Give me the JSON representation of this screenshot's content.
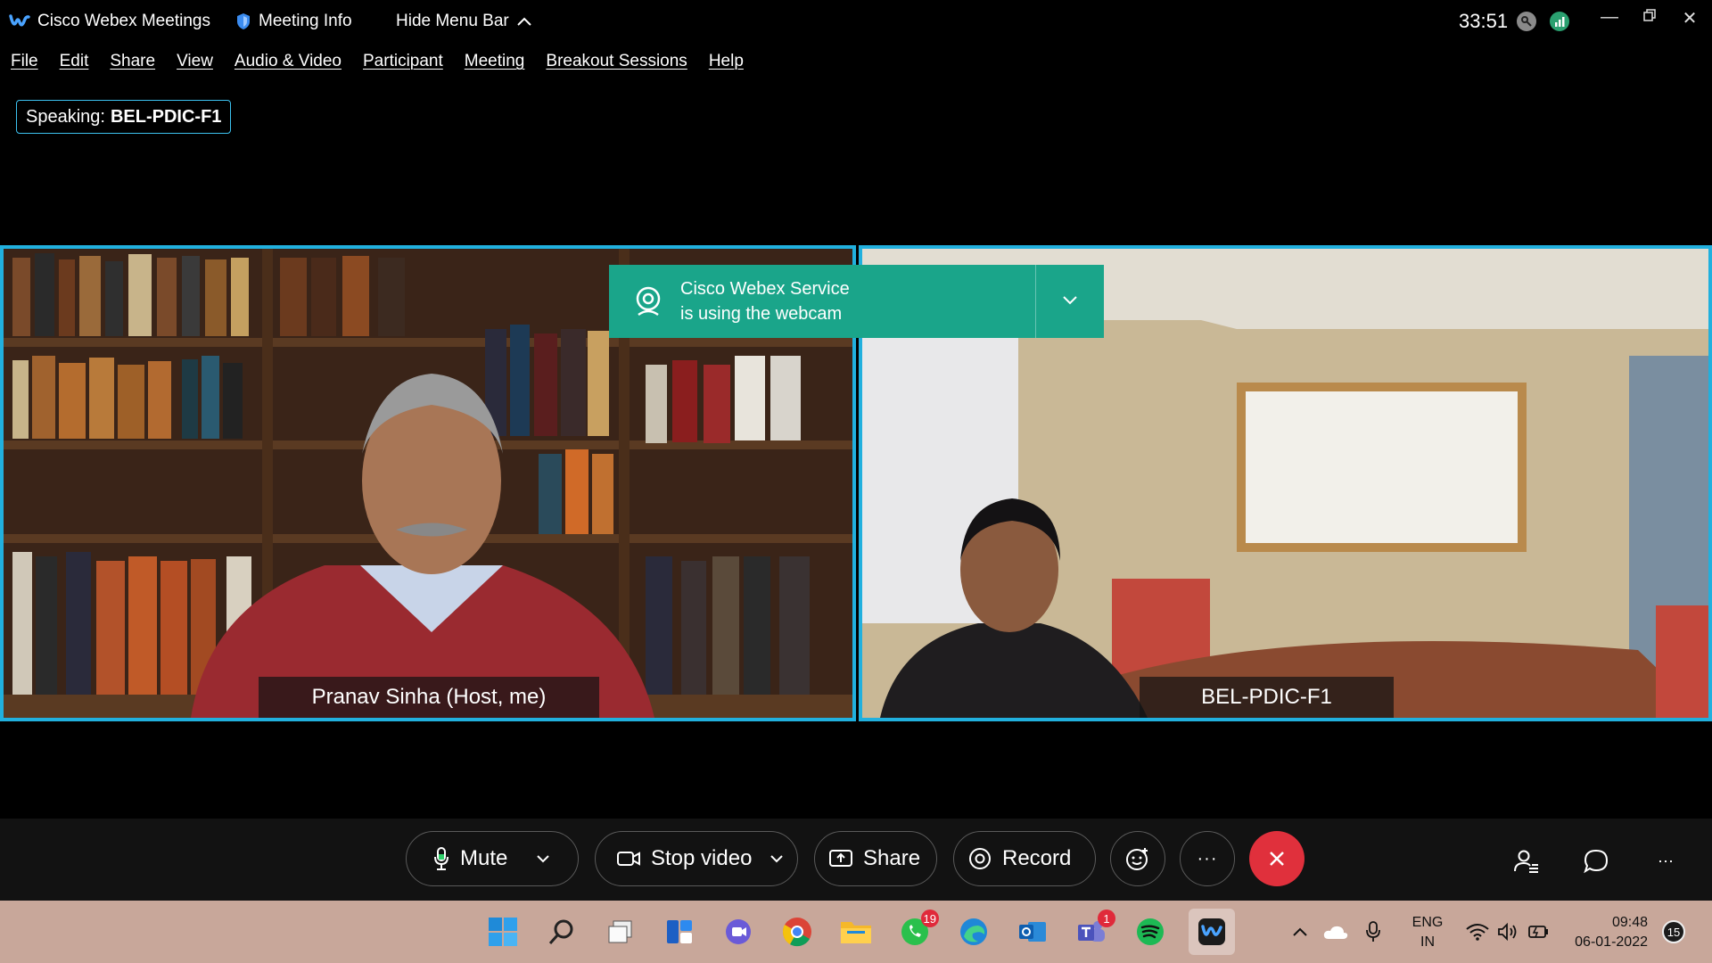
{
  "window": {
    "app_title": "Cisco Webex Meetings",
    "meeting_info": "Meeting Info",
    "hide_menu_bar": "Hide Menu Bar",
    "timer": "33:51"
  },
  "menu": [
    "File",
    "Edit",
    "Share",
    "View",
    "Audio & Video",
    "Participant",
    "Meeting",
    "Breakout Sessions",
    "Help"
  ],
  "speaking": {
    "label": "Speaking:",
    "name": "BEL-PDIC-F1"
  },
  "tiles": {
    "left_name": "Pranav Sinha  (Host, me)",
    "right_name": "BEL-PDIC-F1"
  },
  "notification": {
    "line1": "Cisco Webex Service",
    "line2": "is using the webcam"
  },
  "controls": {
    "mute": "Mute",
    "stop_video": "Stop video",
    "share": "Share",
    "record": "Record",
    "more": "···"
  },
  "taskbar": {
    "whatsapp_badge": "19",
    "teams_badge": "1",
    "lang_line1": "ENG",
    "lang_line2": "IN",
    "time": "09:48",
    "date": "06-01-2022",
    "notif_count": "15"
  },
  "colors": {
    "accent_border": "#21b0de",
    "notification_bg": "#1aa58a",
    "end_button": "#e0303c",
    "taskbar_bg": "#c8a79a"
  }
}
